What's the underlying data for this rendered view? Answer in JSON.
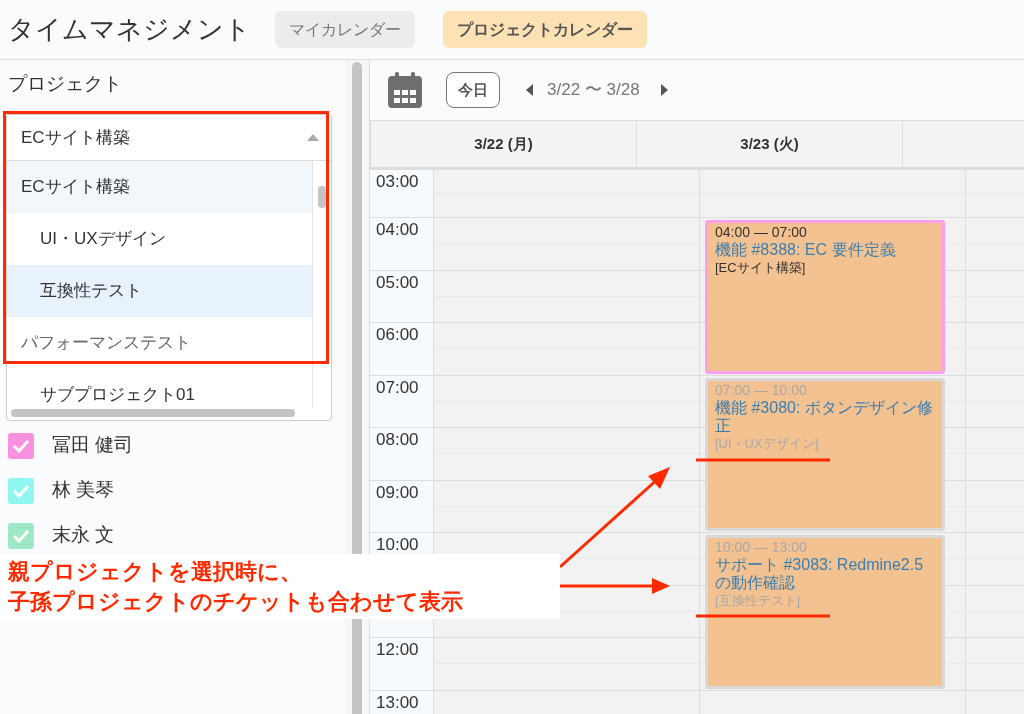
{
  "app_title": "タイムマネジメント",
  "tabs": [
    {
      "label": "マイカレンダー",
      "selected": false
    },
    {
      "label": "プロジェクトカレンダー",
      "selected": true
    }
  ],
  "sidebar": {
    "heading": "プロジェクト",
    "project_select": {
      "value": "ECサイト構築",
      "expanded": true,
      "options": [
        {
          "label": "ECサイト構築",
          "selected": true,
          "hovered": false,
          "children": [
            {
              "label": "UI・UXデザイン",
              "selected": false,
              "hovered": false
            },
            {
              "label": "互換性テスト",
              "selected": false,
              "hovered": true
            }
          ]
        },
        {
          "label": "パフォーマンステスト",
          "selected": false,
          "hovered": false,
          "children": [
            {
              "label": "サブプロジェクト01",
              "selected": false,
              "hovered": false
            }
          ]
        }
      ]
    },
    "members": [
      {
        "name": "冨田 健司",
        "checked": true,
        "color": "#f990e0"
      },
      {
        "name": "林 美琴",
        "checked": true,
        "color": "#8ff6f0"
      },
      {
        "name": "末永 文",
        "checked": true,
        "color": "#9ee8c6"
      }
    ]
  },
  "calendar": {
    "today_button": "今日",
    "range": "3/22 〜 3/28",
    "hours": [
      "03:00",
      "04:00",
      "05:00",
      "06:00",
      "07:00",
      "08:00",
      "09:00",
      "10:00",
      "12:00",
      "13:00"
    ],
    "days": [
      {
        "label": "3/22 (月)"
      },
      {
        "label": "3/23 (火)",
        "events": [
          {
            "time": "04:00 — 07:00",
            "title": "機能 #8388: EC 要件定義",
            "project": "[ECサイト構築]",
            "highlighted": true
          },
          {
            "time": "07:00 — 10:00",
            "title": "機能 #3080: ボタンデザイン修正",
            "project": "[UI・UXデザイン]",
            "highlighted": false
          },
          {
            "time": "10:00 — 13:00",
            "title": "サポート #3083: Redmine2.5の動作確認",
            "project": "[互換性テスト]",
            "highlighted": false
          }
        ]
      }
    ]
  },
  "annotation": {
    "lines": [
      "親プロジェクトを選択時に、",
      "子孫プロジェクトのチケットも合わせて表示"
    ]
  }
}
